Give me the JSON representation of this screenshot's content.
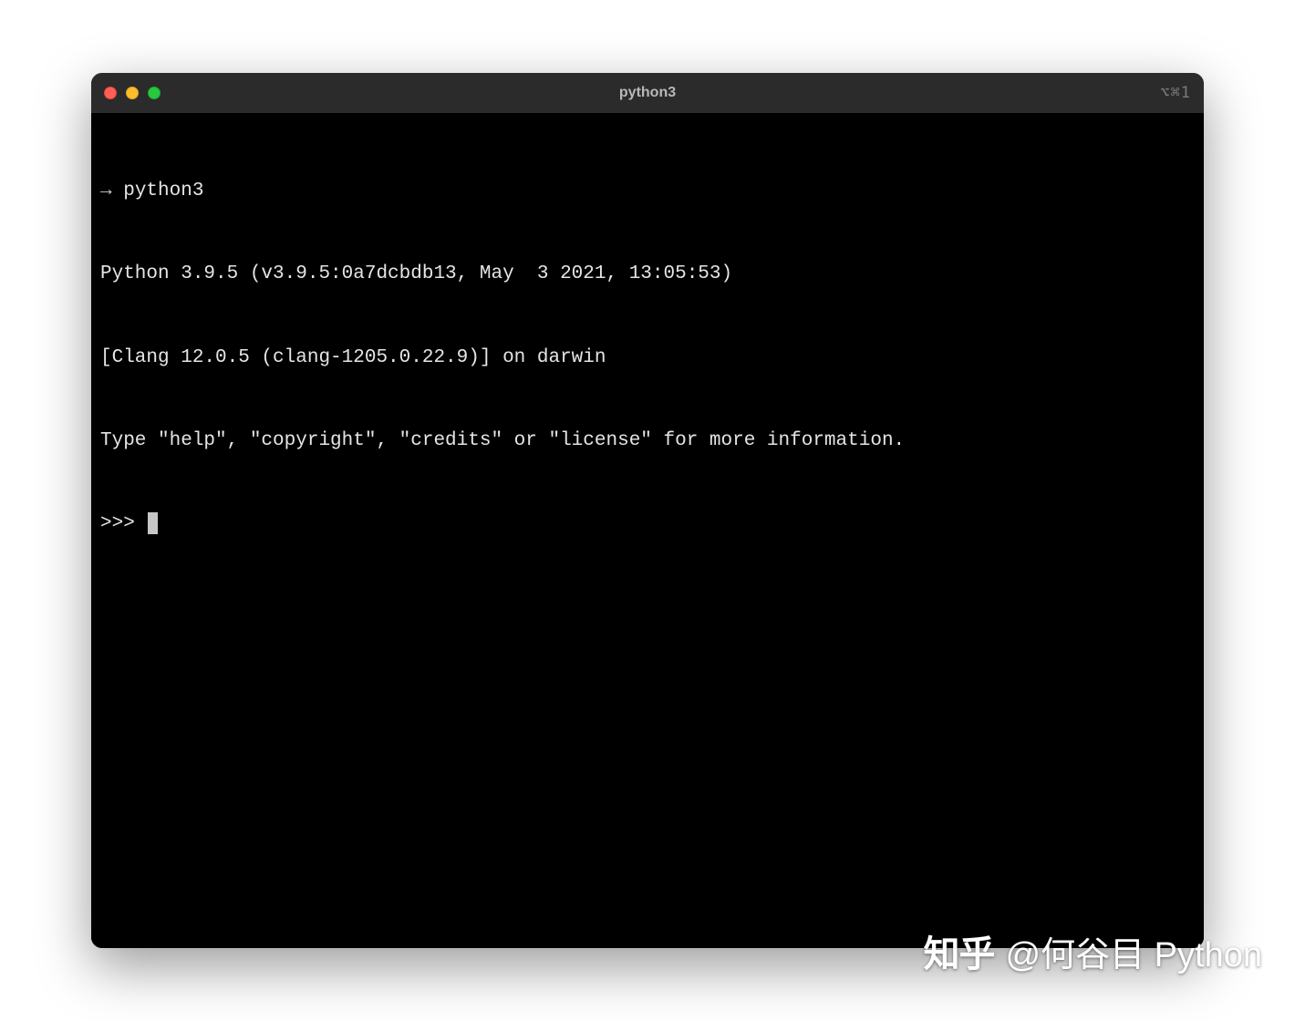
{
  "window": {
    "title": "python3",
    "shortcut_hint": "⌥⌘1"
  },
  "terminal": {
    "shell_prompt_arrow": "→",
    "shell_command": "python3",
    "banner_line1": "Python 3.9.5 (v3.9.5:0a7dcbdb13, May  3 2021, 13:05:53)",
    "banner_line2": "[Clang 12.0.5 (clang-1205.0.22.9)] on darwin",
    "banner_line3": "Type \"help\", \"copyright\", \"credits\" or \"license\" for more information.",
    "repl_prompt": ">>> "
  },
  "watermark": {
    "logo_text": "知乎",
    "author": "@何谷目 Python"
  }
}
